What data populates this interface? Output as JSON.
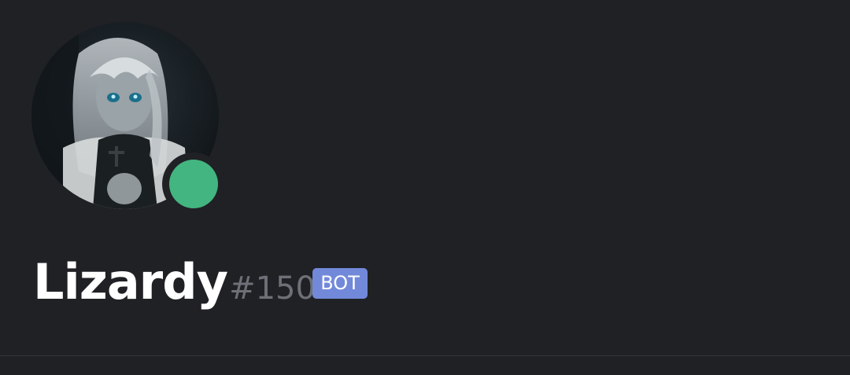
{
  "profile": {
    "username": "Lizardy",
    "discriminator": "#1501",
    "badge": "BOT",
    "avatar_icon": "anime-character-avatar",
    "status": "online",
    "status_color": "#43b581"
  },
  "colors": {
    "background": "#202125",
    "badge_background": "#7289da",
    "discriminator_text": "#6e7078"
  }
}
